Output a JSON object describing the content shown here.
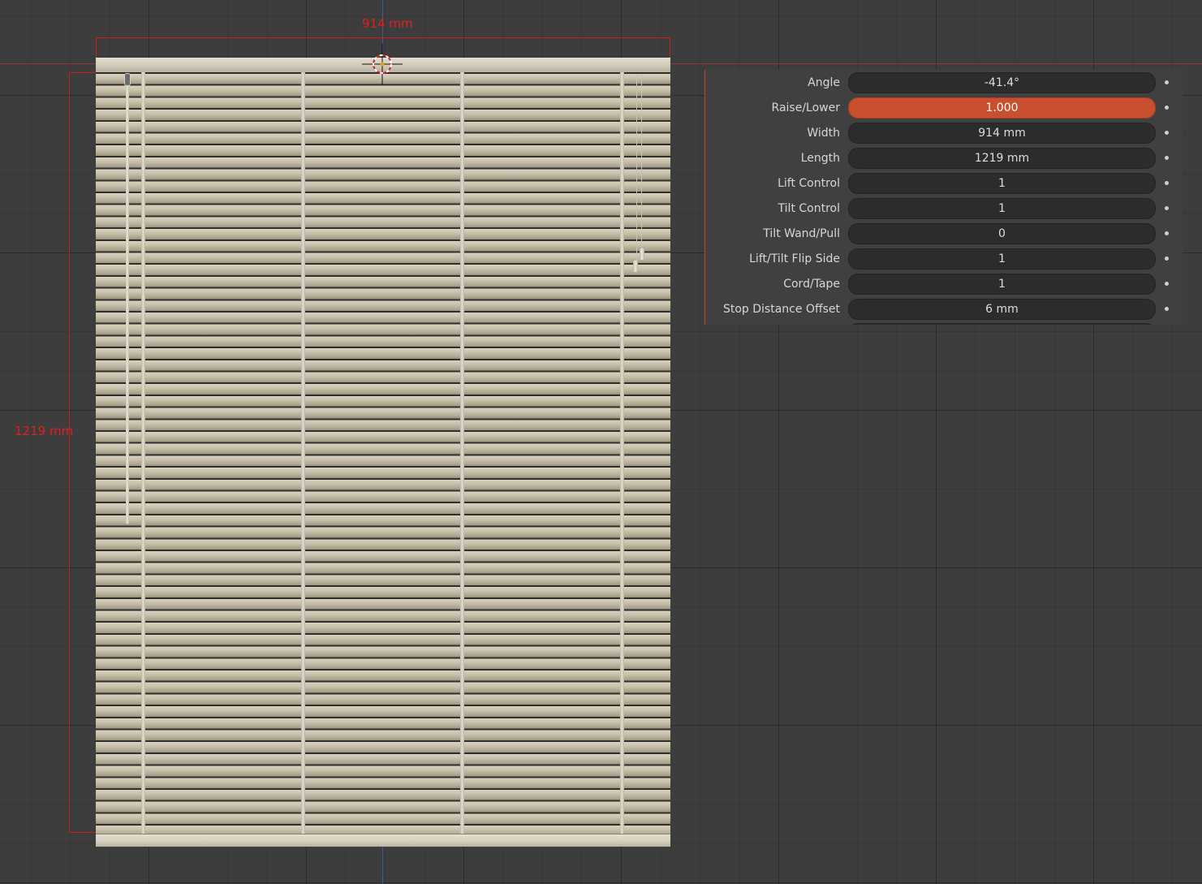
{
  "dimensions": {
    "width_label": "914 mm",
    "length_label": "1219 mm"
  },
  "properties": [
    {
      "label": "Angle",
      "value": "-41.4°",
      "active": false
    },
    {
      "label": "Raise/Lower",
      "value": "1.000",
      "active": true
    },
    {
      "label": "Width",
      "value": "914 mm",
      "active": false
    },
    {
      "label": "Length",
      "value": "1219 mm",
      "active": false
    },
    {
      "label": "Lift Control",
      "value": "1",
      "active": false
    },
    {
      "label": "Tilt Control",
      "value": "1",
      "active": false
    },
    {
      "label": "Tilt Wand/Pull",
      "value": "0",
      "active": false
    },
    {
      "label": "Lift/Tilt Flip Side",
      "value": "1",
      "active": false
    },
    {
      "label": "Cord/Tape",
      "value": "1",
      "active": false
    },
    {
      "label": "Stop Distance Offset",
      "value": "6 mm",
      "active": false
    }
  ],
  "colors": {
    "background": "#3d3d3d",
    "active_field": "#c8502e",
    "dimension": "#e01f1f",
    "slat": "#c9c1ad"
  }
}
